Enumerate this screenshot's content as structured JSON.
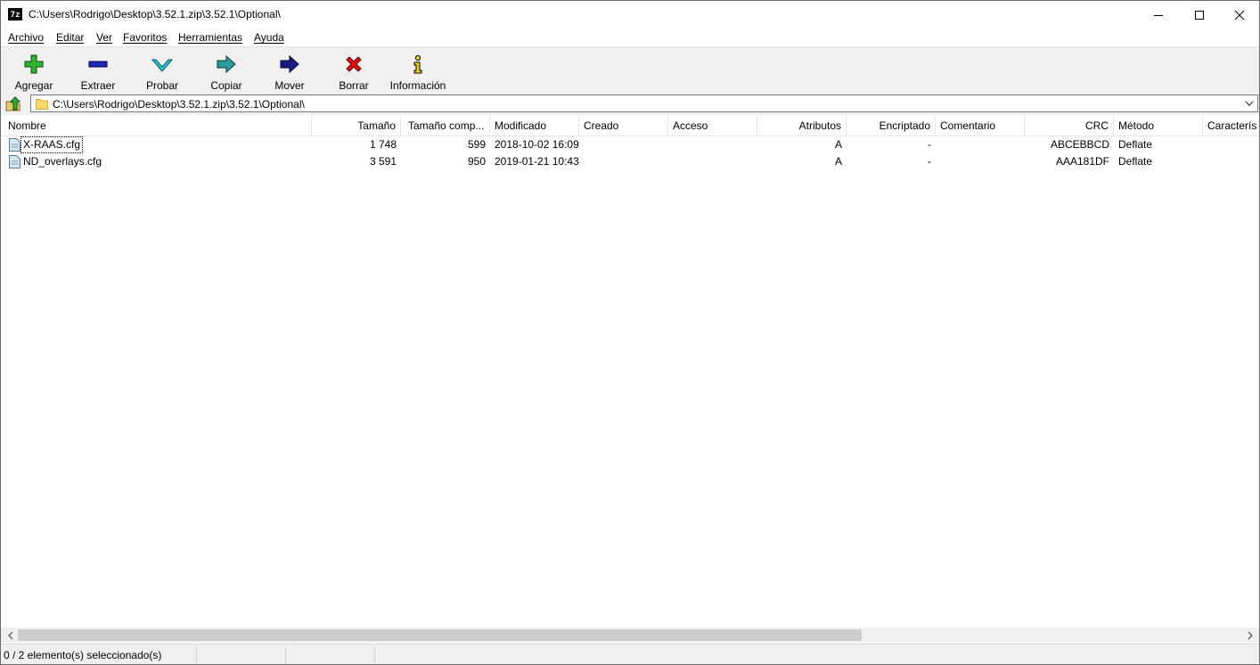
{
  "window": {
    "logo": "7z",
    "title": "C:\\Users\\Rodrigo\\Desktop\\3.52.1.zip\\3.52.1\\Optional\\"
  },
  "menu": [
    "Archivo",
    "Editar",
    "Ver",
    "Favoritos",
    "Herramientas",
    "Ayuda"
  ],
  "toolbar": {
    "add": "Agregar",
    "extract": "Extraer",
    "test": "Probar",
    "copy": "Copiar",
    "move": "Mover",
    "delete": "Borrar",
    "info": "Información"
  },
  "address": {
    "path": "C:\\Users\\Rodrigo\\Desktop\\3.52.1.zip\\3.52.1\\Optional\\"
  },
  "columns": {
    "name": "Nombre",
    "size": "Tamaño",
    "packed": "Tamaño comp...",
    "modified": "Modificado",
    "created": "Creado",
    "accessed": "Acceso",
    "attributes": "Atributos",
    "encrypted": "Encriptado",
    "comment": "Comentario",
    "crc": "CRC",
    "method": "Método",
    "characteristics": "Caracterís"
  },
  "files": [
    {
      "name": "X-RAAS.cfg",
      "size": "1 748",
      "packed": "599",
      "modified": "2018-10-02 16:09",
      "created": "",
      "accessed": "",
      "attributes": "A",
      "encrypted": "-",
      "comment": "",
      "crc": "ABCEBBCD",
      "method": "Deflate"
    },
    {
      "name": "ND_overlays.cfg",
      "size": "3 591",
      "packed": "950",
      "modified": "2019-01-21 10:43",
      "created": "",
      "accessed": "",
      "attributes": "A",
      "encrypted": "-",
      "comment": "",
      "crc": "AAA181DF",
      "method": "Deflate"
    }
  ],
  "status": {
    "selection": "0 / 2 elemento(s) seleccionado(s)"
  },
  "colors": {
    "add_icon": "#2db52d",
    "extract_icon": "#1b2bb0",
    "test_icon": "#2ec7d6",
    "copy_icon": "#2a9a9a",
    "move_icon": "#1a1a80",
    "delete_icon": "#e01010",
    "info_icon": "#e8d020"
  }
}
